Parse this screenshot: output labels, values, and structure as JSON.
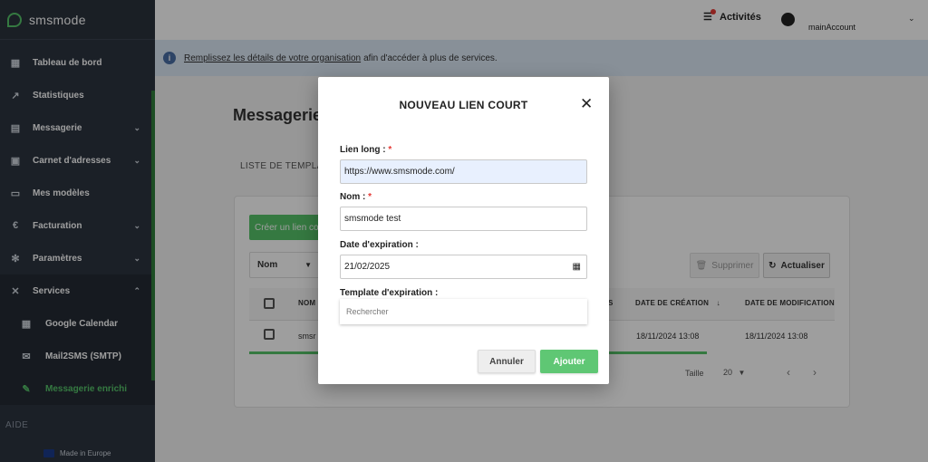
{
  "app": {
    "name": "smsmode"
  },
  "sidebar": {
    "items": [
      {
        "label": "Tableau de bord",
        "icon": "dashboard-icon"
      },
      {
        "label": "Statistiques",
        "icon": "stats-icon"
      },
      {
        "label": "Messagerie",
        "icon": "messages-icon",
        "expandable": true
      },
      {
        "label": "Carnet d'adresses",
        "icon": "address-book-icon",
        "expandable": true
      },
      {
        "label": "Mes modèles",
        "icon": "templates-icon"
      },
      {
        "label": "Facturation",
        "icon": "euro-icon",
        "expandable": true
      },
      {
        "label": "Paramètres",
        "icon": "gear-icon",
        "expandable": true
      },
      {
        "label": "Services",
        "icon": "tools-icon",
        "expanded": true
      }
    ],
    "services_sub": [
      {
        "label": "Google Calendar",
        "icon": "calendar-icon"
      },
      {
        "label": "Mail2SMS (SMTP)",
        "icon": "mail-icon"
      },
      {
        "label": "Messagerie enrichi",
        "icon": "pencil-icon",
        "active": true
      }
    ],
    "aide": "AIDE",
    "made_in": "Made in Europe"
  },
  "topbar": {
    "activites": "Activités",
    "account": "mainAccount"
  },
  "banner": {
    "link_text": "Remplissez les détails de votre organisation",
    "rest_text": "afin d'accéder à plus de services."
  },
  "main": {
    "title": "Messagerie",
    "tab": "LISTE DE TEMPLAT",
    "create_button": "Créer un lien co",
    "filter_select": "Nom",
    "delete_button": "Supprimer",
    "refresh_button": "Actualiser",
    "table": {
      "headers": [
        "NOM",
        "S",
        "DATE DE CRÉATION",
        "DATE DE MODIFICATION"
      ],
      "rows": [
        {
          "name": "smsr",
          "created": "18/11/2024 13:08",
          "modified": "18/11/2024 13:08"
        }
      ]
    },
    "pager": {
      "label": "Taille",
      "size": "20"
    }
  },
  "modal": {
    "title": "NOUVEAU LIEN COURT",
    "long_link_label": "Lien long :",
    "long_link_value": "https://www.smsmode.com/",
    "name_label": "Nom :",
    "name_value": "smsmode test",
    "expiration_label": "Date d'expiration :",
    "expiration_value": "21/02/2025",
    "template_label": "Template d'expiration :",
    "search_placeholder": "Rechercher",
    "required_mark": "*",
    "cancel_button": "Annuler",
    "add_button": "Ajouter"
  },
  "colors": {
    "sidebar_bg": "#2c3440",
    "accent_green": "#56c46a",
    "banner_bg": "#dce8f6",
    "required_red": "#e53935"
  }
}
